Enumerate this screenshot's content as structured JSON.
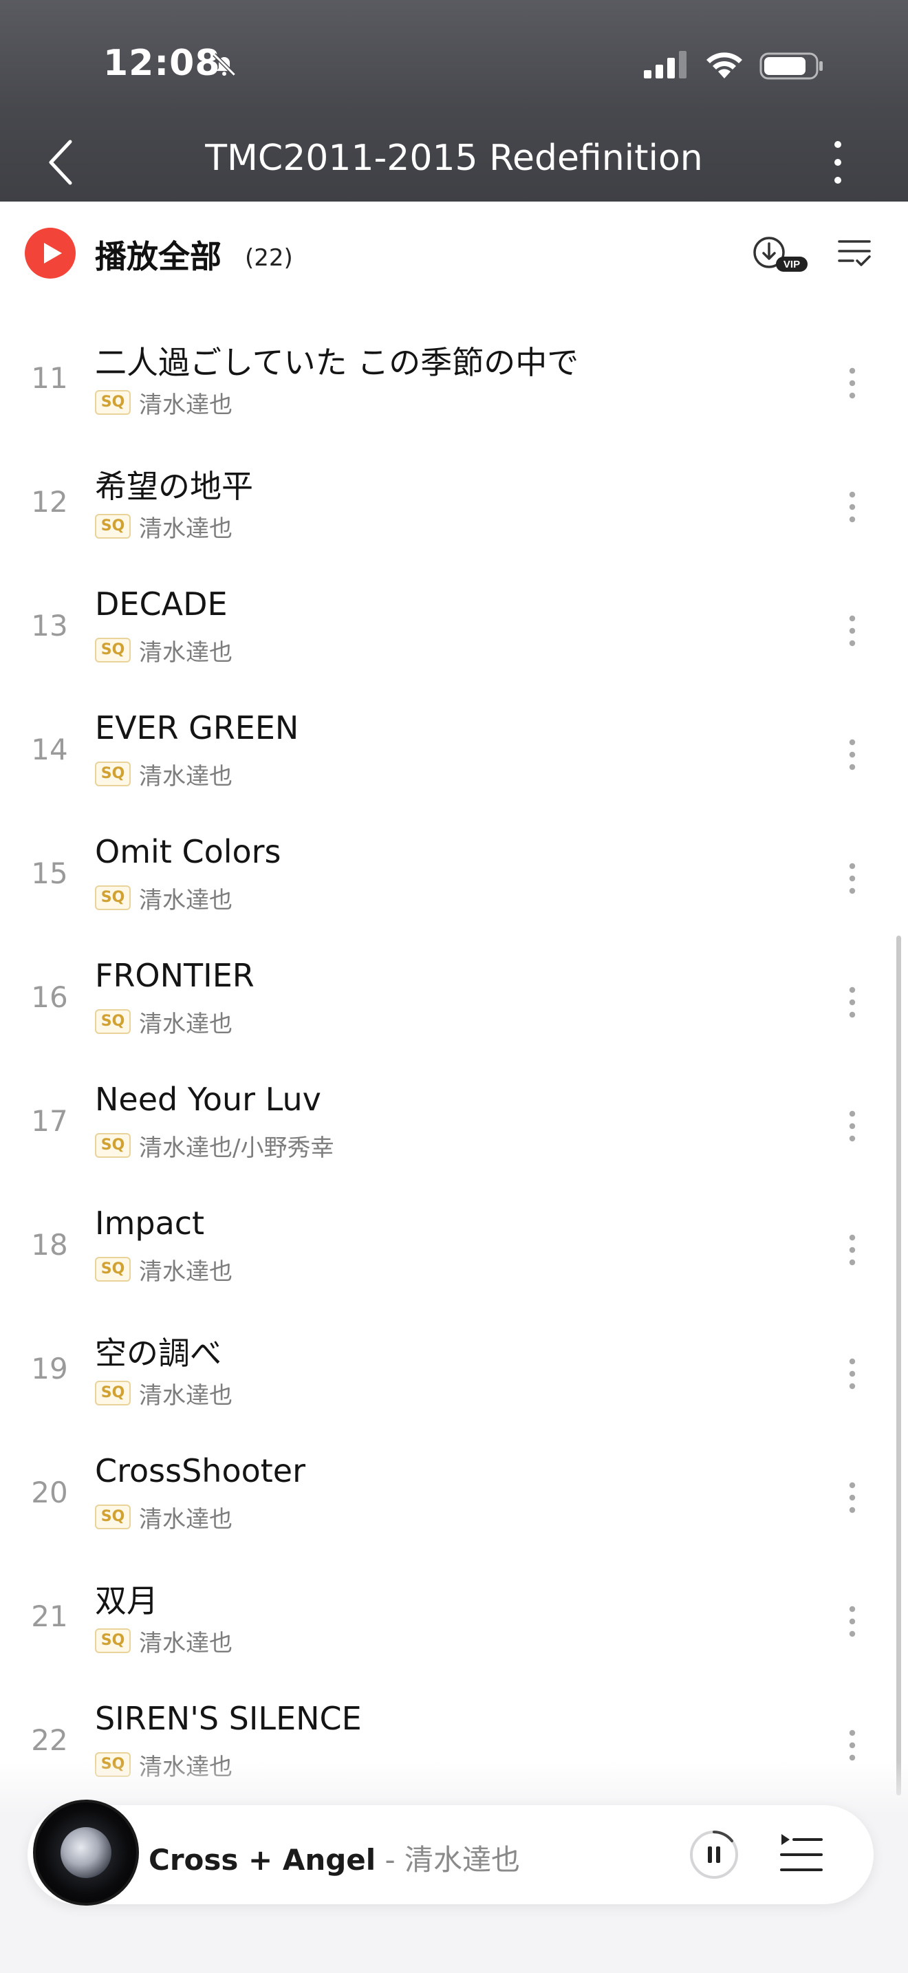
{
  "status_bar": {
    "time": "12:08"
  },
  "header": {
    "title": "TMC2011-2015 Redefinition"
  },
  "play_all": {
    "label": "播放全部",
    "count": "(22)"
  },
  "quality_badge": "SQ",
  "tracks": [
    {
      "num": "11",
      "title": "二人過ごしていた この季節の中で",
      "artist": "清水達也"
    },
    {
      "num": "12",
      "title": "希望の地平",
      "artist": "清水達也"
    },
    {
      "num": "13",
      "title": "DECADE",
      "artist": "清水達也"
    },
    {
      "num": "14",
      "title": "EVER GREEN",
      "artist": "清水達也"
    },
    {
      "num": "15",
      "title": "Omit Colors",
      "artist": "清水達也"
    },
    {
      "num": "16",
      "title": "FRONTIER",
      "artist": "清水達也"
    },
    {
      "num": "17",
      "title": "Need Your Luv",
      "artist": "清水達也/小野秀幸"
    },
    {
      "num": "18",
      "title": "Impact",
      "artist": "清水達也"
    },
    {
      "num": "19",
      "title": "空の調べ",
      "artist": "清水達也"
    },
    {
      "num": "20",
      "title": "CrossShooter",
      "artist": "清水達也"
    },
    {
      "num": "21",
      "title": "双月",
      "artist": "清水達也"
    },
    {
      "num": "22",
      "title": "SIREN'S SILENCE",
      "artist": "清水達也"
    }
  ],
  "now_playing": {
    "title": "Cross + Angel",
    "separator": " - ",
    "artist": "清水達也"
  },
  "colors": {
    "accent": "#f24438",
    "header_bg": "#4a4b50",
    "sq_badge": "#d1a132"
  }
}
